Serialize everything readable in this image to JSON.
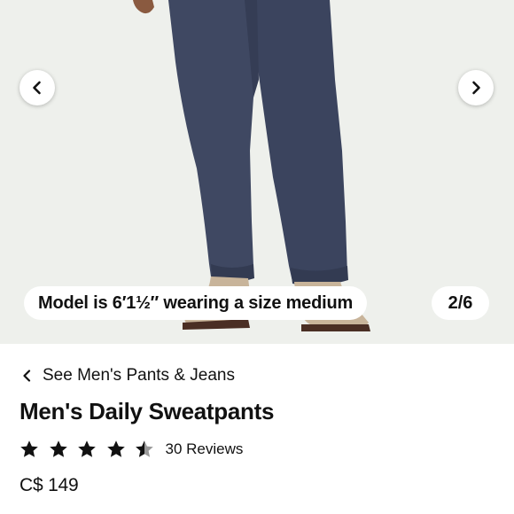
{
  "gallery": {
    "caption": "Model is 6′1½″ wearing a size medium",
    "counter": "2/6",
    "prev_icon": "chevron-left-icon",
    "next_icon": "chevron-right-icon"
  },
  "breadcrumb": {
    "label": "See Men's Pants & Jeans",
    "icon": "chevron-left-icon"
  },
  "product": {
    "title": "Men's Daily Sweatpants",
    "rating": 4.5,
    "rating_max": 5,
    "reviews_label": "30 Reviews",
    "price": "C$ 149"
  },
  "colors": {
    "gallery_bg": "#eef0ec",
    "pants": "#3f4862",
    "star": "#111111"
  }
}
